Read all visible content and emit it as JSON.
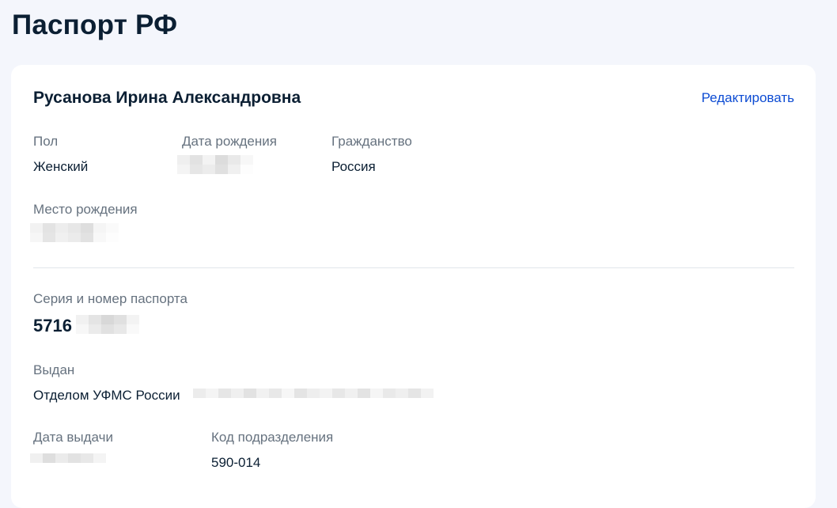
{
  "page": {
    "title": "Паспорт РФ"
  },
  "person": {
    "full_name": "Русанова Ирина Александровна",
    "edit_label": "Редактировать"
  },
  "fields": {
    "gender": {
      "label": "Пол",
      "value": "Женский"
    },
    "birth_date": {
      "label": "Дата рождения"
    },
    "citizenship": {
      "label": "Гражданство",
      "value": "Россия"
    },
    "birth_place": {
      "label": "Место рождения"
    },
    "passport_number": {
      "label": "Серия и номер паспорта",
      "value": "5716"
    },
    "issued_by": {
      "label": "Выдан",
      "value": "Отделом УФМС России"
    },
    "issue_date": {
      "label": "Дата выдачи"
    },
    "division_code": {
      "label": "Код подразделения",
      "value": "590-014"
    }
  },
  "colors": {
    "background": "#f4f6fc",
    "card": "#ffffff",
    "text": "#0b1f33",
    "label": "#66727f",
    "link": "#0d4cd3",
    "divider": "#e1e5eb"
  }
}
